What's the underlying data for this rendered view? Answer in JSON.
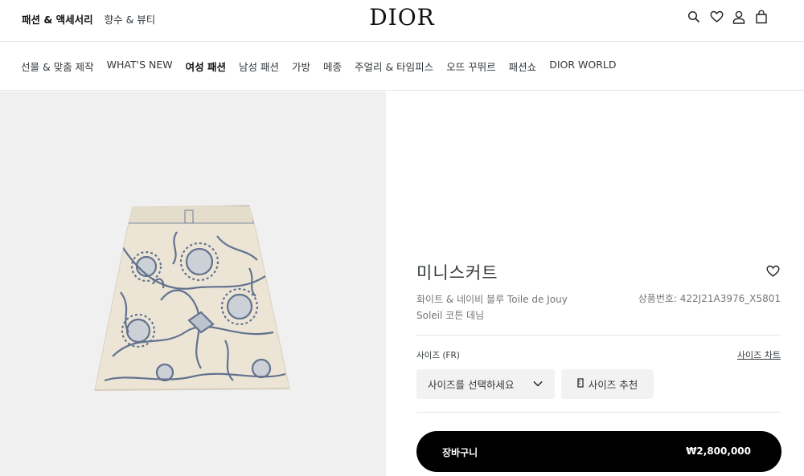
{
  "header": {
    "top_links": [
      "패션 & 액세서리",
      "향수 & 뷰티"
    ],
    "logo": "DIOR",
    "icons": [
      "search-icon",
      "heart-icon",
      "user-icon",
      "bag-icon"
    ]
  },
  "nav": {
    "items": [
      "선물 & 맞춤 제작",
      "WHAT'S NEW",
      "여성 패션",
      "남성 패션",
      "가방",
      "메종",
      "주얼리 & 타임피스",
      "오뜨 꾸뛰르",
      "패션쇼",
      "DIOR WORLD"
    ]
  },
  "product": {
    "title": "미니스커트",
    "description": "화이트 & 네이비 블루 Toile de Jouy Soleil 코튼 데님",
    "reference": "상품번호: 422J21A3976_X5801",
    "size_label": "사이즈 (FR)",
    "size_chart": "사이즈 차트",
    "size_select": "사이즈를 선택하세요",
    "size_recommend": "사이즈 추천",
    "cart_label": "장바구니",
    "price": "₩2,800,000"
  },
  "colors": {
    "cart_bg": "#000000",
    "image_bg": "#f0f0f0",
    "skirt_base": "#ece5d6",
    "skirt_print": "#4a5f82"
  }
}
